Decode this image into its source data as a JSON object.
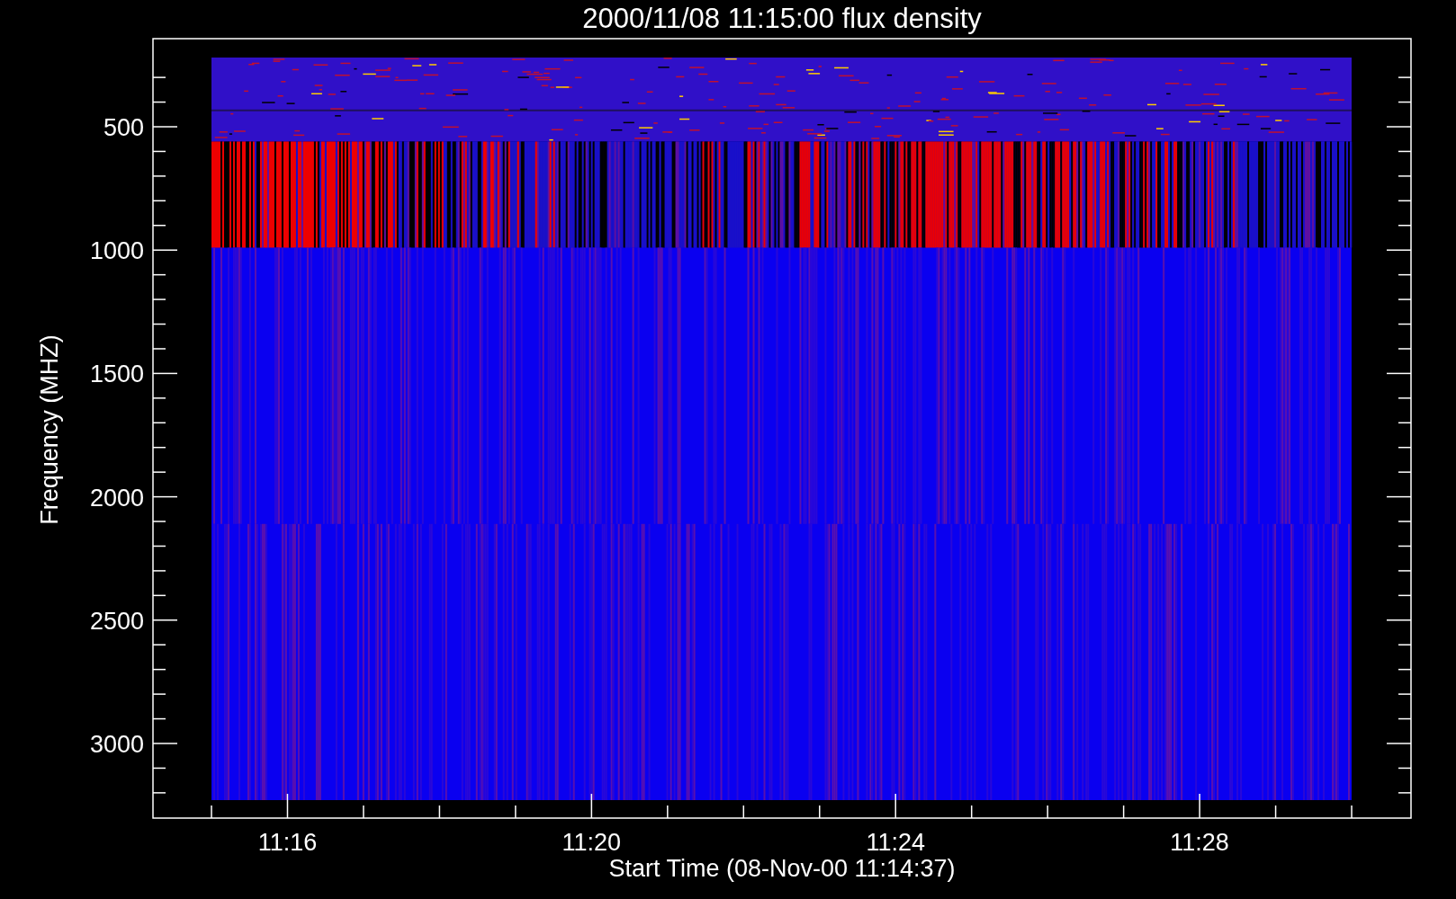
{
  "plot": {
    "title": "2000/11/08 11:15:00 flux density",
    "ylabel": "Frequency (MHZ)",
    "xlabel": "Start Time (08-Nov-00 11:14:37)",
    "yticks": [
      "500",
      "1000",
      "1500",
      "2000",
      "2500",
      "3000"
    ],
    "xticks": [
      "11:16",
      "11:20",
      "11:24",
      "11:28"
    ]
  }
}
